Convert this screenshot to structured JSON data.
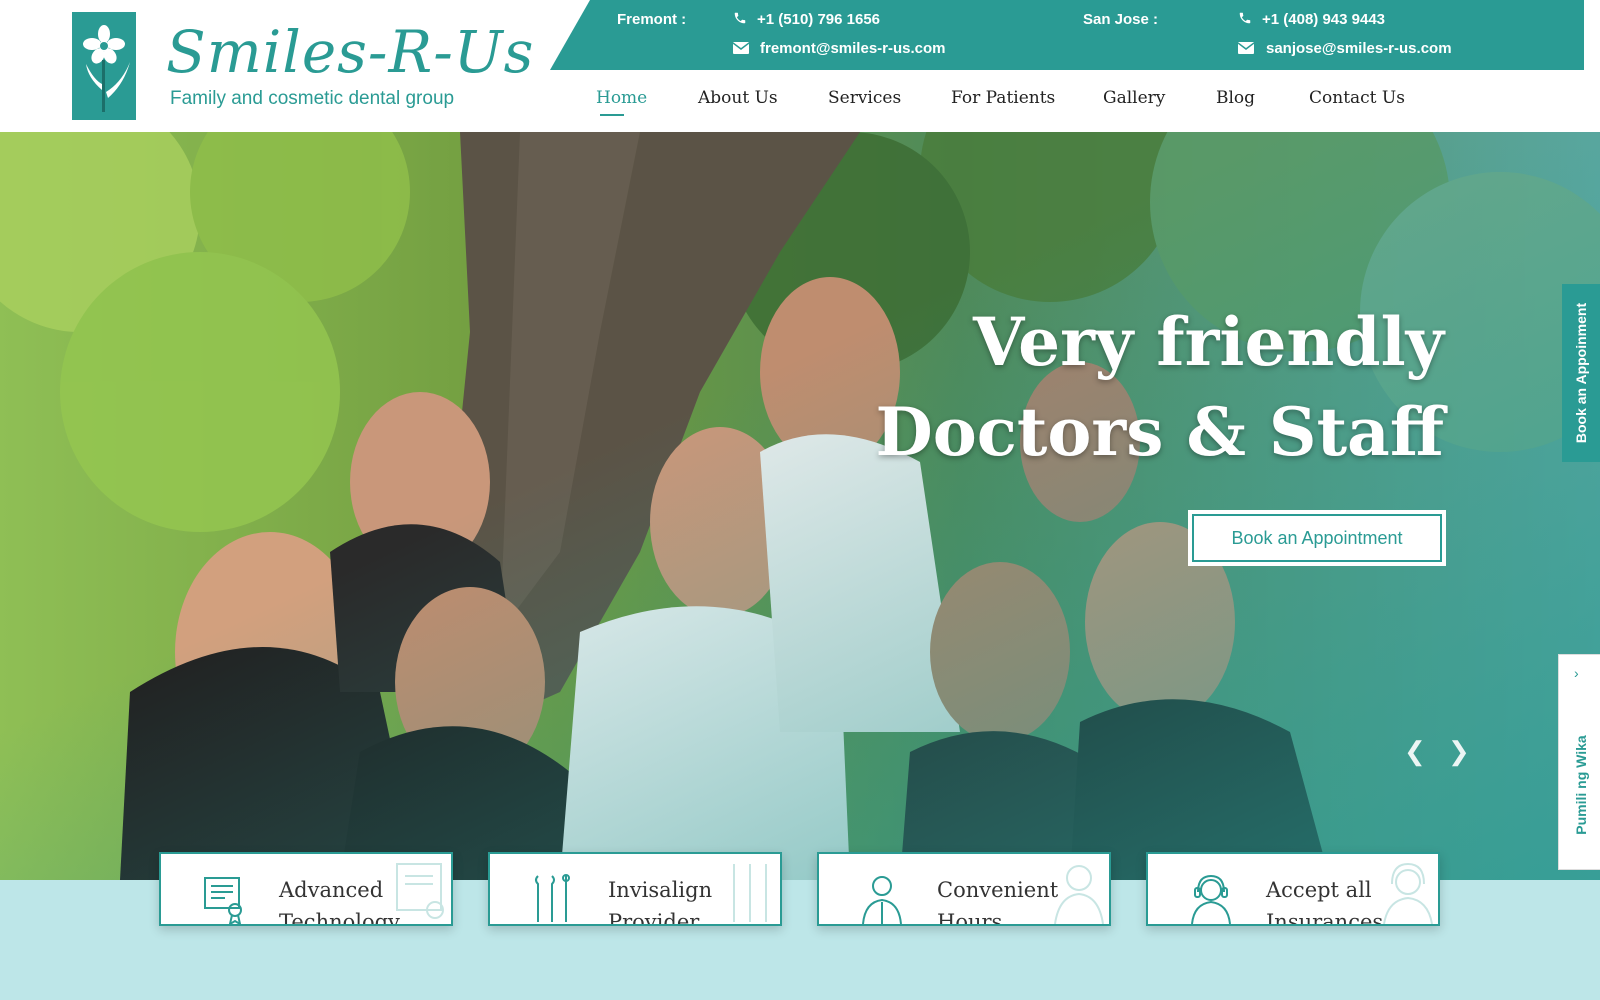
{
  "header": {
    "brand": "Smiles-R-Us",
    "tagline": "Family and cosmetic dental group"
  },
  "contact": {
    "fremont_label": "Fremont :",
    "fremont_phone": "+1 (510) 796 1656",
    "fremont_email": "fremont@smiles-r-us.com",
    "sanjose_label": "San Jose :",
    "sanjose_phone": "+1 (408) 943 9443",
    "sanjose_email": "sanjose@smiles-r-us.com"
  },
  "nav": {
    "items": [
      "Home",
      "About Us",
      "Services",
      "For Patients",
      "Gallery",
      "Blog",
      "Contact Us"
    ],
    "active": "Home"
  },
  "hero": {
    "title_line1": "Very friendly",
    "title_line2": "Doctors & Staff",
    "button": "Book an Appointment",
    "prev_arrow": "❮",
    "next_arrow": "❯"
  },
  "side_tabs": {
    "book": "Book an Appoinment",
    "review": "Pumili ng Wika",
    "chevron": "›"
  },
  "features": [
    {
      "title": "Advanced Technology",
      "icon": "certificate-icon"
    },
    {
      "title": "Invisalign Provider",
      "icon": "dental-tools-icon"
    },
    {
      "title": "Convenient Hours",
      "icon": "doctor-icon"
    },
    {
      "title": "Accept all Insurances",
      "icon": "headset-support-icon"
    }
  ],
  "colors": {
    "accent": "#2a9b94",
    "strip": "#bde6e8"
  }
}
